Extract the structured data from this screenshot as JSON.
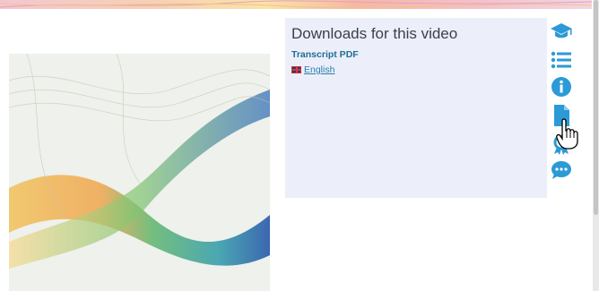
{
  "downloads": {
    "title": "Downloads for this video",
    "section_label": "Transcript PDF",
    "language_link": "English"
  },
  "icons": [
    "graduation-cap-icon",
    "list-icon",
    "info-icon",
    "document-icon",
    "award-icon",
    "chat-icon"
  ],
  "colors": {
    "panel_bg": "#eceff9",
    "icon_blue": "#2b9ad6",
    "link_blue": "#2b7db0"
  }
}
